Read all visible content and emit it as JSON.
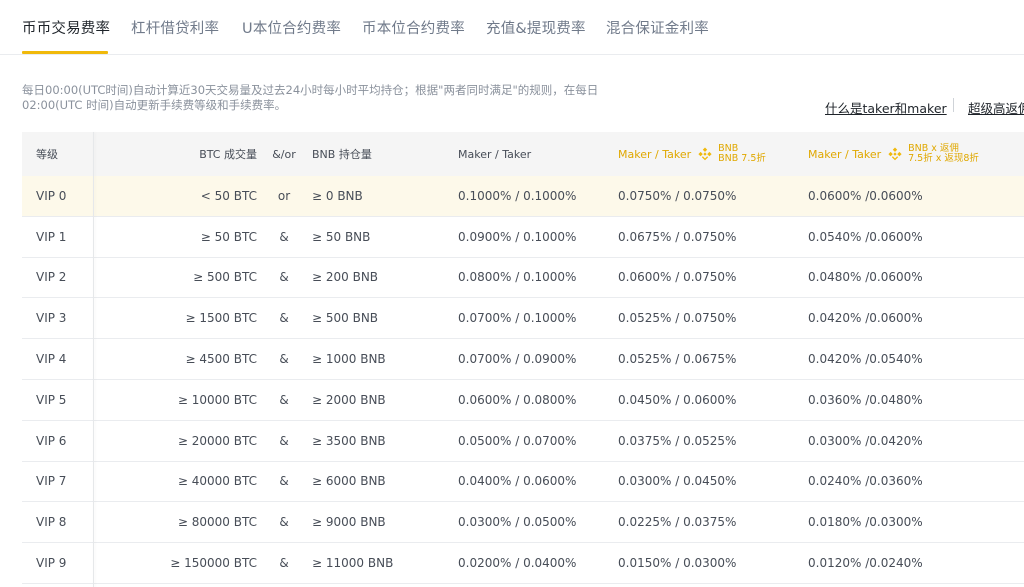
{
  "tabs": [
    {
      "label": "币币交易费率",
      "active": true
    },
    {
      "label": "杠杆借贷利率"
    },
    {
      "label": "U本位合约费率"
    },
    {
      "label": "币本位合约费率"
    },
    {
      "label": "充值&提现费率"
    },
    {
      "label": "混合保证金利率"
    }
  ],
  "note": "每日00:00(UTC时间)自动计算近30天交易量及过去24小时每小时平均持仓；根据\"两者同时满足\"的规则，在每日02:00(UTC 时间)自动更新手续费等级和手续费率。",
  "links": {
    "taker_maker": "什么是taker和maker",
    "high_freq": "超级高返佣"
  },
  "colors": {
    "accent": "#f0b90b",
    "highlight_row": "#fdf9ea"
  },
  "table": {
    "headers": {
      "level": "等级",
      "btc_volume": "BTC 成交量",
      "andor": "&/or",
      "bnb_holding": "BNB 持仓量",
      "maker_taker": "Maker / Taker",
      "bnb_maker_taker": "Maker / Taker",
      "bnb_line1": "BNB",
      "bnb_line2": "BNB 7.5折",
      "rebate_maker_taker": "Maker / Taker",
      "rebate_line1": "BNB x 返佣",
      "rebate_line2": "7.5折 x 返现8折",
      "bnb_icon": "bnb-coin-icon"
    },
    "rows": [
      {
        "level": "VIP 0",
        "btc": "< 50 BTC",
        "op": "or",
        "bnb": "≥ 0 BNB",
        "mt": "0.1000% / 0.1000%",
        "bnb_mt": "0.0750% / 0.0750%",
        "rebate": "0.0600% /0.0600%"
      },
      {
        "level": "VIP 1",
        "btc": "≥ 50 BTC",
        "op": "&",
        "bnb": "≥ 50 BNB",
        "mt": "0.0900% / 0.1000%",
        "bnb_mt": "0.0675% / 0.0750%",
        "rebate": "0.0540% /0.0600%"
      },
      {
        "level": "VIP 2",
        "btc": "≥ 500 BTC",
        "op": "&",
        "bnb": "≥ 200 BNB",
        "mt": "0.0800% / 0.1000%",
        "bnb_mt": "0.0600% / 0.0750%",
        "rebate": "0.0480% /0.0600%"
      },
      {
        "level": "VIP 3",
        "btc": "≥ 1500 BTC",
        "op": "&",
        "bnb": "≥ 500 BNB",
        "mt": "0.0700% / 0.1000%",
        "bnb_mt": "0.0525% / 0.0750%",
        "rebate": "0.0420% /0.0600%"
      },
      {
        "level": "VIP 4",
        "btc": "≥ 4500 BTC",
        "op": "&",
        "bnb": "≥ 1000 BNB",
        "mt": "0.0700% / 0.0900%",
        "bnb_mt": "0.0525% / 0.0675%",
        "rebate": "0.0420% /0.0540%"
      },
      {
        "level": "VIP 5",
        "btc": "≥ 10000 BTC",
        "op": "&",
        "bnb": "≥ 2000 BNB",
        "mt": "0.0600% / 0.0800%",
        "bnb_mt": "0.0450% / 0.0600%",
        "rebate": "0.0360% /0.0480%"
      },
      {
        "level": "VIP 6",
        "btc": "≥ 20000 BTC",
        "op": "&",
        "bnb": "≥ 3500 BNB",
        "mt": "0.0500% / 0.0700%",
        "bnb_mt": "0.0375% / 0.0525%",
        "rebate": "0.0300% /0.0420%"
      },
      {
        "level": "VIP 7",
        "btc": "≥ 40000 BTC",
        "op": "&",
        "bnb": "≥ 6000 BNB",
        "mt": "0.0400% / 0.0600%",
        "bnb_mt": "0.0300% / 0.0450%",
        "rebate": "0.0240% /0.0360%"
      },
      {
        "level": "VIP 8",
        "btc": "≥ 80000 BTC",
        "op": "&",
        "bnb": "≥ 9000 BNB",
        "mt": "0.0300% / 0.0500%",
        "bnb_mt": "0.0225% / 0.0375%",
        "rebate": "0.0180% /0.0300%"
      },
      {
        "level": "VIP 9",
        "btc": "≥ 150000 BTC",
        "op": "&",
        "bnb": "≥ 11000 BNB",
        "mt": "0.0200% / 0.0400%",
        "bnb_mt": "0.0150% / 0.0300%",
        "rebate": "0.0120% /0.0240%"
      }
    ]
  }
}
